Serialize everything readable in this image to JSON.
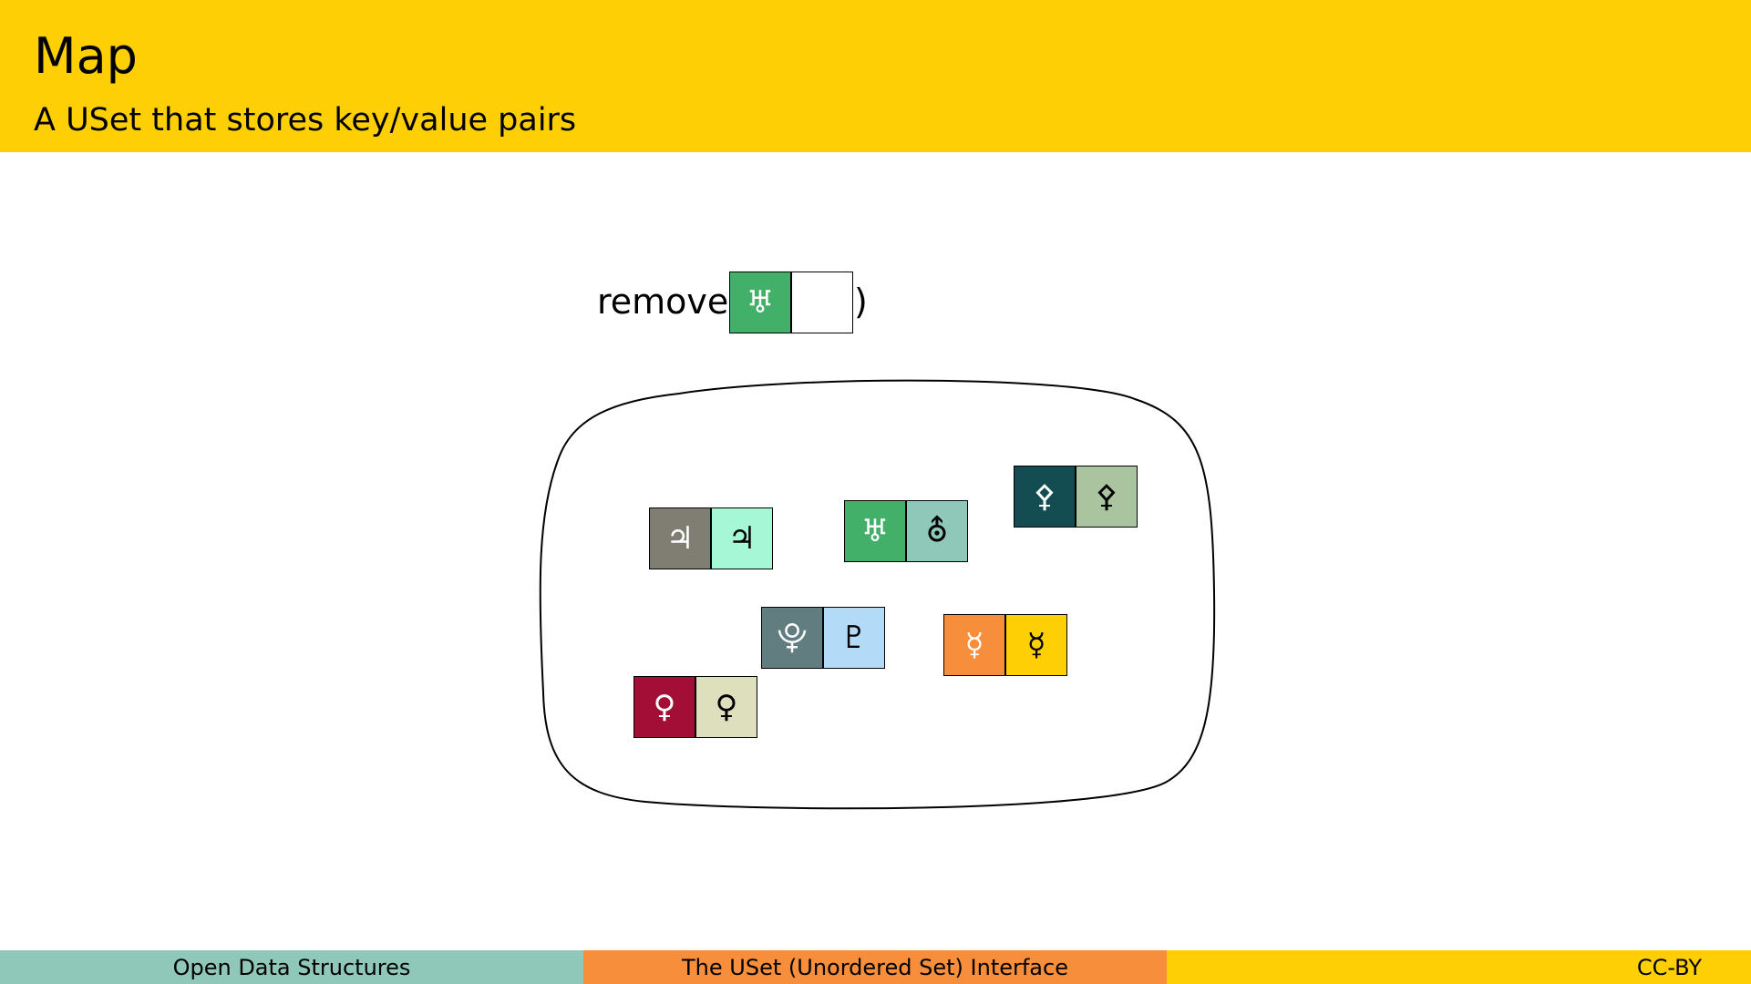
{
  "slide": {
    "title": "Map",
    "subtitle": "A USet that stores key/value pairs"
  },
  "operation": {
    "name": "remove(",
    "close": ")",
    "key_symbol": "♅",
    "key_color": "#43B06A",
    "value_symbol": "",
    "value_color": "#FFFFFF"
  },
  "pairs": [
    {
      "key": "♃",
      "key_color": "#807E73",
      "value": "♃",
      "value_color": "#A6F7D5"
    },
    {
      "key": "♅",
      "key_color": "#43B06A",
      "value": "⛢",
      "value_color": "#8FC7B8"
    },
    {
      "key": "⚴",
      "key_color": "#134D52",
      "value": "⚴",
      "value_color": "#ABC4A0"
    },
    {
      "key": "⯓",
      "key_color": "#617D80",
      "value": "♇",
      "value_color": "#B3DBF7"
    },
    {
      "key": "☿",
      "key_color": "#F78E3B",
      "value": "☿",
      "value_color": "#FFCF05"
    },
    {
      "key": "♀",
      "key_color": "#A30E36",
      "value": "♀",
      "value_color": "#DEE0BD"
    }
  ],
  "footer": {
    "left": "Open Data Structures",
    "center": "The USet (Unordered Set) Interface",
    "right": "CC-BY",
    "left_color": "#8FC7B8",
    "center_color": "#F78E3B",
    "right_color": "#FFCF05"
  }
}
